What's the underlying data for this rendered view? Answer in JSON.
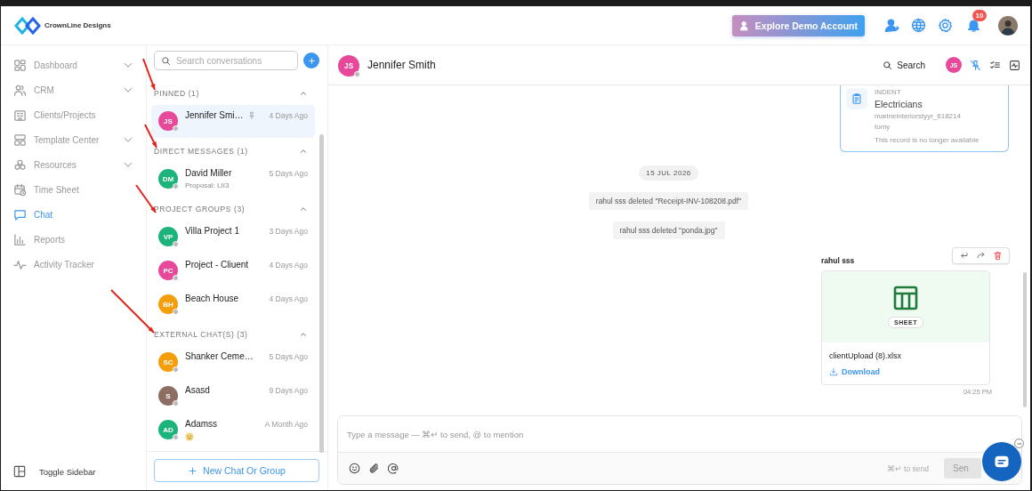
{
  "brand": {
    "name": "CrownLine Designs"
  },
  "header": {
    "demo_button": "Explore Demo Account",
    "notification_count": "10"
  },
  "sidebar": {
    "items": [
      {
        "label": "Dashboard",
        "expandable": true,
        "selected": false
      },
      {
        "label": "CRM",
        "expandable": true,
        "selected": false
      },
      {
        "label": "Clients/Projects",
        "expandable": false,
        "selected": false
      },
      {
        "label": "Template Center",
        "expandable": true,
        "selected": false
      },
      {
        "label": "Resources",
        "expandable": true,
        "selected": false
      },
      {
        "label": "Time Sheet",
        "expandable": false,
        "selected": false
      },
      {
        "label": "Chat",
        "expandable": false,
        "selected": true
      },
      {
        "label": "Reports",
        "expandable": false,
        "selected": false
      },
      {
        "label": "Activity Tracker",
        "expandable": false,
        "selected": false
      }
    ],
    "toggle": "Toggle Sidebar"
  },
  "conversations": {
    "search_placeholder": "Search conversations",
    "sections": [
      {
        "title": "PINNED (1)",
        "expanded": true,
        "items": [
          {
            "initials": "JS",
            "color": "#e8489a",
            "name": "Jennifer Smi…",
            "time": "4 Days Ago",
            "pinned": true,
            "selected": true,
            "online": false
          }
        ]
      },
      {
        "title": "DIRECT MESSAGES (1)",
        "expanded": true,
        "items": [
          {
            "initials": "DM",
            "color": "#1cb47a",
            "name": "David Miller",
            "time": "5 Days Ago",
            "preview": "Proposal: LII3",
            "pinned": false,
            "selected": false,
            "online": false
          }
        ]
      },
      {
        "title": "PROJECT GROUPS (3)",
        "expanded": true,
        "items": [
          {
            "initials": "VP",
            "color": "#1cb47a",
            "name": "Villa Project 1",
            "time": "3 Days Ago",
            "pinned": false,
            "selected": false,
            "online": false
          },
          {
            "initials": "PC",
            "color": "#e8489a",
            "name": "Project - Cliuent",
            "time": "4 Days Ago",
            "pinned": false,
            "selected": false,
            "online": false
          },
          {
            "initials": "BH",
            "color": "#f59e0b",
            "name": "Beach House",
            "time": "4 Days Ago",
            "pinned": false,
            "selected": false,
            "online": false
          }
        ]
      },
      {
        "title": "EXTERNAL CHAT(S) (3)",
        "expanded": true,
        "items": [
          {
            "initials": "SC",
            "color": "#f59e0b",
            "name": "Shanker Ceme…",
            "time": "5 Days Ago",
            "pinned": false,
            "selected": false,
            "online": false
          },
          {
            "initials": "S",
            "color": "#8d6e63",
            "name": "Asasd",
            "time": "9 Days Ago",
            "pinned": false,
            "selected": false,
            "online": false
          },
          {
            "initials": "AD",
            "color": "#1cb47a",
            "name": "Adamss",
            "time": "A Month Ago",
            "preview_emoji": true,
            "pinned": false,
            "selected": false,
            "online": false
          }
        ]
      }
    ],
    "new_button": "New Chat Or Group"
  },
  "chat": {
    "initials": "JS",
    "color": "#e8489a",
    "name": "Jennifer Smith",
    "online": false,
    "search": "Search",
    "participant_initials": "JS",
    "record": {
      "label": "INDENT",
      "title": "Electricians",
      "lines": [
        "marineinteriorstyyr_618214",
        "tomy"
      ],
      "note": "This record is no longer available"
    },
    "messages": [
      {
        "kind": "date",
        "text": "15 JUL 2026"
      },
      {
        "kind": "system",
        "text": "rahul sss deleted \"Receipt-INV-108208.pdf\""
      },
      {
        "kind": "system",
        "text": "rahul sss deleted \"ponda.jpg\""
      },
      {
        "kind": "file",
        "sender": "rahul sss",
        "badge": "SHEET",
        "filename": "clientUpload (8).xlsx",
        "action": "Download",
        "time": "04:25 PM"
      }
    ],
    "composer": {
      "placeholder": "Type a message — ⌘↵ to send, @ to mention",
      "hint": "⌘↵ to send",
      "send": "Sen",
      "send_disabled": true
    }
  }
}
